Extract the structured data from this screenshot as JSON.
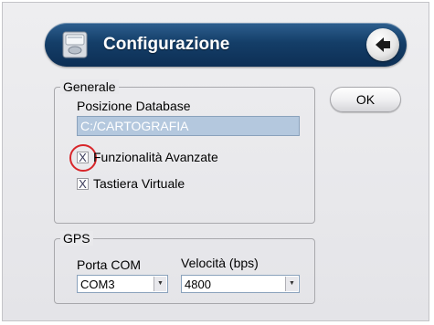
{
  "window": {
    "title": "Configurazione",
    "ok_label": "OK"
  },
  "general": {
    "group_label": "Generale",
    "db_label": "Posizione Database",
    "db_value": "C:/CARTOGRAFIA",
    "advanced_label": "Funzionalità Avanzate",
    "advanced_checked": true,
    "keyboard_label": "Tastiera Virtuale",
    "keyboard_checked": true,
    "check_glyph": "X"
  },
  "gps": {
    "group_label": "GPS",
    "port_label": "Porta COM",
    "port_value": "COM3",
    "speed_label": "Velocità (bps)",
    "speed_value": "4800",
    "dropdown_glyph": "▼"
  },
  "colors": {
    "title_bar": "#143e68",
    "highlight": "#d8262a",
    "textbox_bg": "#b4c8de"
  },
  "icons": {
    "app": "database-icon",
    "back": "back-arrow-icon",
    "dropdown": "chevron-down-icon"
  }
}
